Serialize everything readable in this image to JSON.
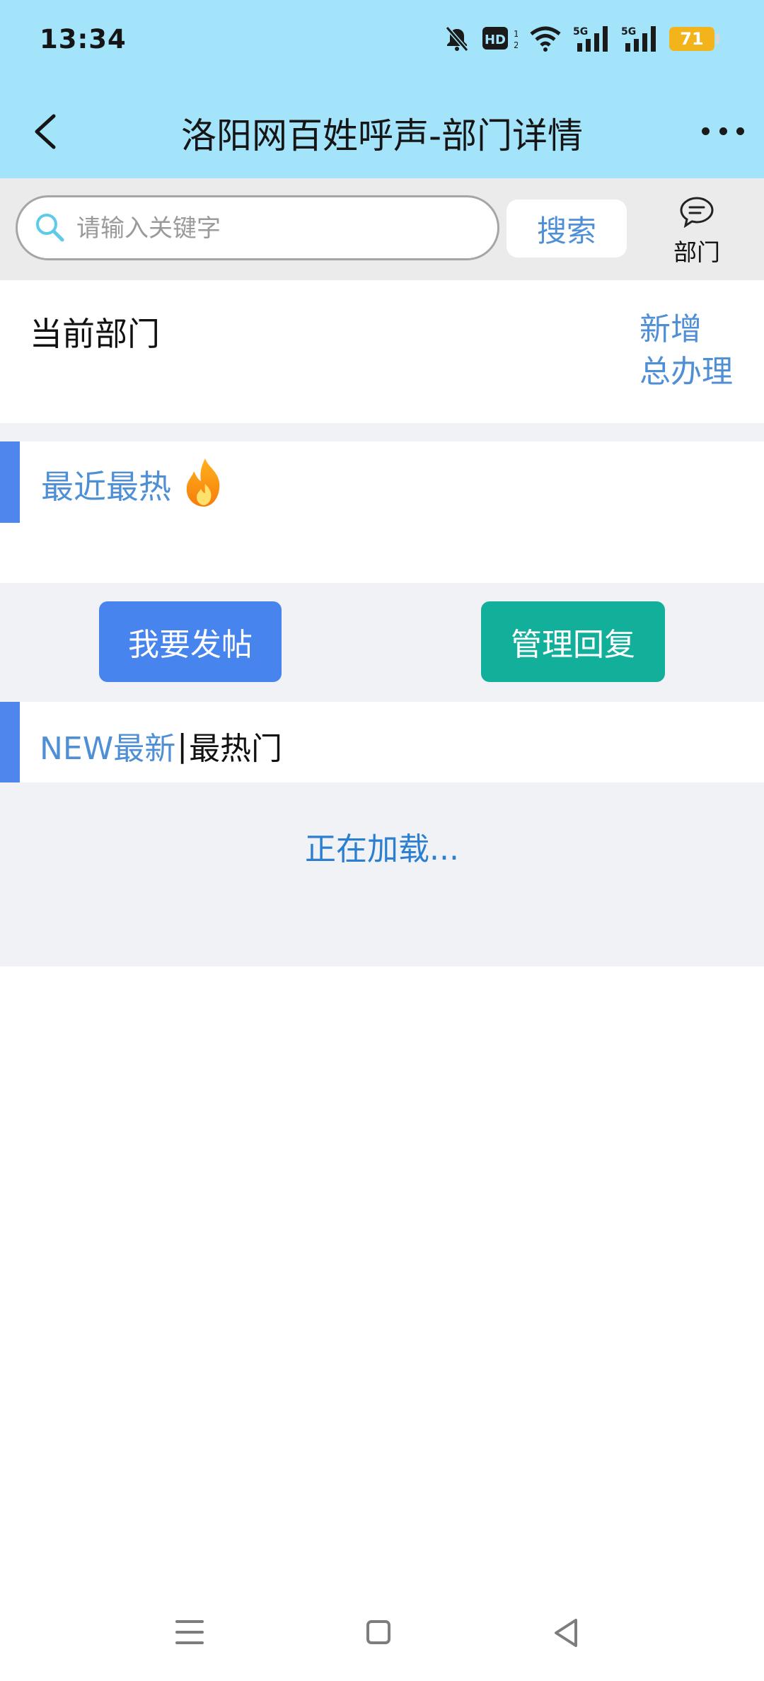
{
  "status_bar": {
    "time": "13:34",
    "battery": "71",
    "icons": [
      "mute-bell-icon",
      "hd-icon",
      "wifi-icon",
      "signal-5g-icon",
      "signal-5g-icon",
      "battery-icon"
    ]
  },
  "header": {
    "title": "洛阳网百姓呼声-部门详情",
    "back_icon": "chevron-left-icon",
    "more_icon": "more-dots-icon"
  },
  "search": {
    "placeholder": "请输入关键字",
    "value": "",
    "button_label": "搜索",
    "dept_label": "部门",
    "dept_icon": "chat-bubble-icon"
  },
  "current_department": {
    "label": "当前部门",
    "action_line1": "新增",
    "action_line2": "总办理"
  },
  "hot": {
    "title": "最近最热",
    "icon": "flame-icon"
  },
  "actions": {
    "post_label": "我要发帖",
    "manage_label": "管理回复"
  },
  "tabs": {
    "new_label": "NEW最新",
    "separator": "|",
    "hot_label": "最热门"
  },
  "loading_text": "正在加载...",
  "colors": {
    "header_bg": "#a3e4fb",
    "accent_blue": "#4884ee",
    "link_blue": "#4e8fd6",
    "teal": "#12b09a",
    "battery": "#f3b31a"
  },
  "nav": {
    "icons": [
      "menu-icon",
      "home-icon",
      "back-triangle-icon"
    ]
  }
}
